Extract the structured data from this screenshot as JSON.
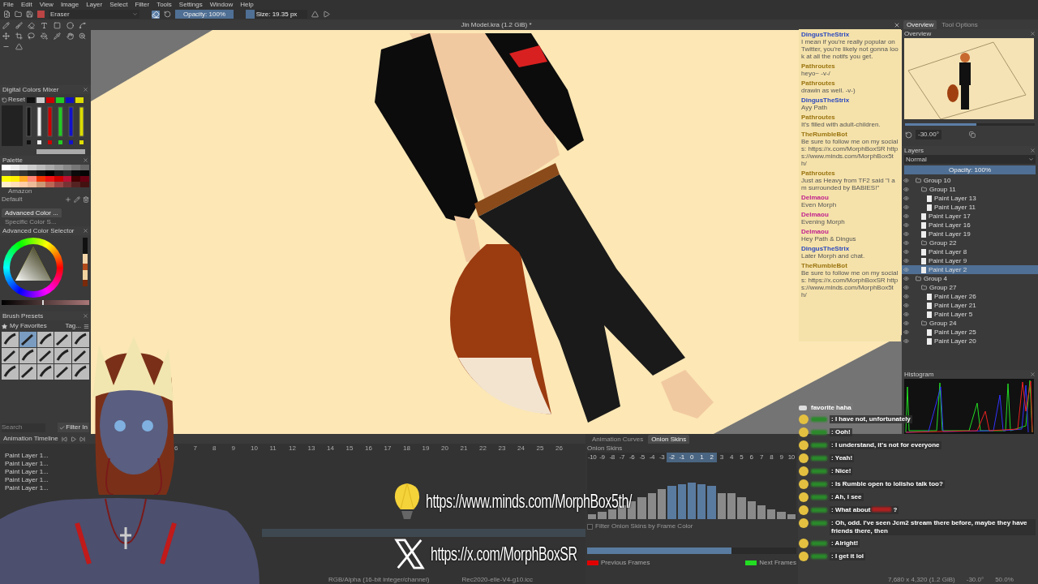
{
  "menu": [
    "File",
    "Edit",
    "View",
    "Image",
    "Layer",
    "Select",
    "Filter",
    "Tools",
    "Settings",
    "Window",
    "Help"
  ],
  "toolbar": {
    "preset": "Eraser",
    "opacity": {
      "text": "Opacity: 100%",
      "level": 1
    },
    "size": {
      "text": "Size: 19.35 px",
      "level": 0.15
    }
  },
  "mixer": {
    "title": "Digital Colors Mixer",
    "reset": "Reset",
    "colors": [
      {
        "color": "#111111"
      },
      {
        "color": "#cccccc"
      },
      {
        "color": "#cc0000"
      },
      {
        "color": "#22cc22"
      },
      {
        "color": "#1010c0"
      },
      {
        "color": "#dddd00"
      }
    ]
  },
  "palette": {
    "title": "Palette",
    "name": "Amazon",
    "set": "Default"
  },
  "color_tabs": [
    {
      "label": "Advanced Color ...",
      "selected": true
    },
    {
      "label": "Specific Color S...",
      "selected": false
    }
  ],
  "color_selector": {
    "title": "Advanced Color Selector",
    "value_slider": {
      "level": 0.48
    }
  },
  "brushes": {
    "title": "Brush Presets",
    "tag": "My Favorites",
    "tag_button": "Tag...",
    "placeholder": "Search",
    "filter": "Filter In",
    "filter_checked": true
  },
  "document": {
    "title": "Jin Model.kra (1.2 GiB) *"
  },
  "right_tabs": [
    {
      "label": "Overview",
      "selected": true
    },
    {
      "label": "Tool Options",
      "selected": false
    }
  ],
  "overview": {
    "title": "Overview",
    "rotation": "-30.00°",
    "zoom_slider": {
      "level": 0.55
    }
  },
  "layers": {
    "title": "Layers",
    "blend": "Normal",
    "opacity": {
      "text": "Opacity: 100%",
      "level": 1
    },
    "items": [
      {
        "name": "Group 10",
        "kind": "group",
        "selected": false,
        "children": [
          {
            "name": "Group 11",
            "kind": "group",
            "selected": false,
            "children": [
              {
                "name": "Paint Layer 13",
                "kind": "paint",
                "selected": false
              },
              {
                "name": "Paint Layer 11",
                "kind": "paint",
                "selected": false
              }
            ]
          },
          {
            "name": "Paint Layer 17",
            "kind": "paint",
            "selected": false
          },
          {
            "name": "Paint Layer 16",
            "kind": "paint",
            "selected": false
          },
          {
            "name": "Paint Layer 19",
            "kind": "paint",
            "selected": false
          },
          {
            "name": "Group 22",
            "kind": "group",
            "selected": false
          },
          {
            "name": "Paint Layer 8",
            "kind": "paint",
            "selected": false
          },
          {
            "name": "Paint Layer 9",
            "kind": "paint",
            "selected": false
          },
          {
            "name": "Paint Layer 2",
            "kind": "paint",
            "selected": true
          }
        ]
      },
      {
        "name": "Group 4",
        "kind": "group",
        "selected": false,
        "children": [
          {
            "name": "Group 27",
            "kind": "group",
            "selected": false,
            "children": [
              {
                "name": "Paint Layer 26",
                "kind": "paint",
                "selected": false
              },
              {
                "name": "Paint Layer 21",
                "kind": "paint",
                "selected": false
              },
              {
                "name": "Paint Layer 5",
                "kind": "paint",
                "selected": false
              }
            ]
          },
          {
            "name": "Group 24",
            "kind": "group",
            "selected": false,
            "children": [
              {
                "name": "Paint Layer 25",
                "kind": "paint",
                "selected": false
              },
              {
                "name": "Paint Layer 20",
                "kind": "paint",
                "selected": false
              }
            ]
          }
        ]
      }
    ]
  },
  "histogram": {
    "title": "Histogram"
  },
  "timeline": {
    "title": "Animation Timeline",
    "layers": [
      "Paint Layer 1...",
      "Paint Layer 1...",
      "Paint Layer 1...",
      "Paint Layer 1...",
      "Paint Layer 1..."
    ],
    "frames": [
      "6",
      "7",
      "8",
      "9",
      "10",
      "11",
      "12",
      "13",
      "14",
      "15",
      "16",
      "17",
      "18",
      "19",
      "20",
      "21",
      "22",
      "23",
      "24",
      "25",
      "26"
    ]
  },
  "onion": {
    "tabs": [
      {
        "label": "Animation Curves",
        "selected": false
      },
      {
        "label": "Onion Skins",
        "selected": true
      }
    ],
    "title": "Onion Skins",
    "frames": [
      {
        "label": "-10",
        "level": 0.08,
        "selected": false
      },
      {
        "label": "-9",
        "level": 0.13,
        "selected": false
      },
      {
        "label": "-8",
        "level": 0.17,
        "selected": false
      },
      {
        "label": "-7",
        "level": 0.24,
        "selected": false
      },
      {
        "label": "-6",
        "level": 0.31,
        "selected": false
      },
      {
        "label": "-5",
        "level": 0.38,
        "selected": false
      },
      {
        "label": "-4",
        "level": 0.46,
        "selected": false
      },
      {
        "label": "-3",
        "level": 0.53,
        "selected": false
      },
      {
        "label": "-2",
        "level": 0.59,
        "selected": true
      },
      {
        "label": "-1",
        "level": 0.62,
        "selected": true
      },
      {
        "label": "0",
        "level": 0.64,
        "selected": true
      },
      {
        "label": "1",
        "level": 0.62,
        "selected": true
      },
      {
        "label": "2",
        "level": 0.59,
        "selected": true
      },
      {
        "label": "3",
        "level": 0.46,
        "selected": false
      },
      {
        "label": "4",
        "level": 0.46,
        "selected": false
      },
      {
        "label": "5",
        "level": 0.38,
        "selected": false
      },
      {
        "label": "6",
        "level": 0.31,
        "selected": false
      },
      {
        "label": "7",
        "level": 0.24,
        "selected": false
      },
      {
        "label": "8",
        "level": 0.17,
        "selected": false
      },
      {
        "label": "9",
        "level": 0.13,
        "selected": false
      },
      {
        "label": "10",
        "level": 0.09,
        "selected": false
      }
    ],
    "filter": {
      "label": "Filter Onion Skins by Frame Color",
      "checked": false
    },
    "frame_slider": {
      "level": 0.69
    },
    "frame_sets": [
      {
        "label": "Previous Frames",
        "color": "#e00000"
      },
      {
        "label": "Next Frames",
        "color": "#22dd22"
      }
    ]
  },
  "status": {
    "profile": "RGB/Alpha (16-bit integer/channel)",
    "icc": "Rec2020-elle-V4-g10.icc",
    "size": "7,680 x 4,320 (1.2 GiB)",
    "rotation": "-30.0°",
    "zoom": "50.0%"
  },
  "chat": [
    {
      "user": "DingusTheStrix",
      "color": "#2a48c0",
      "text": "I mean if you're really popular on Twitter, you're likely not gonna look at all the notifs you get."
    },
    {
      "user": "Pathroutes",
      "color": "#9a7410",
      "text": "heyo~ -v-/"
    },
    {
      "user": "Pathroutes",
      "color": "#9a7410",
      "text": "drawin as well. -v-)"
    },
    {
      "user": "DingusTheStrix",
      "color": "#2a48c0",
      "text": "Ayy Path"
    },
    {
      "user": "Pathroutes",
      "color": "#9a7410",
      "text": "It's filled with adult-children."
    },
    {
      "user": "TheRumbleBot",
      "color": "#9a7410",
      "text": "Be sure to follow me on my socials: https://x.com/MorphBoxSR https://www.minds.com/MorphBox5th/"
    },
    {
      "user": "Pathroutes",
      "color": "#9a7410",
      "text": "Just as Heavy from TF2 said \"I am surrounded by BABIES!\""
    },
    {
      "user": "Delmaou",
      "color": "#c0208e",
      "text": "Even Morph"
    },
    {
      "user": "Delmaou",
      "color": "#c0208e",
      "text": "Evening Morph"
    },
    {
      "user": "Delmaou",
      "color": "#c0208e",
      "text": "Hey Path & Dingus"
    },
    {
      "user": "DingusTheStrix",
      "color": "#2a48c0",
      "text": "Later Morph and chat."
    },
    {
      "user": "TheRumbleBot",
      "color": "#9a7410",
      "text": "Be sure to follow me on my socials: https://x.com/MorphBoxSR https://www.minds.com/MorphBox5th/"
    }
  ],
  "chat_feed": {
    "header": "favorite haha",
    "messages": [
      {
        "prefix": ":",
        "text": "I have not, unfortunately",
        "redacted_word": false
      },
      {
        "prefix": ":",
        "text": "Ooh!",
        "redacted_word": false
      },
      {
        "prefix": ":",
        "text": "I understand, it's not for everyone",
        "redacted_word": false
      },
      {
        "prefix": ":",
        "text": "Yeah!",
        "redacted_word": false
      },
      {
        "prefix": ":",
        "text": "Nice!",
        "redacted_word": false
      },
      {
        "prefix": ":",
        "text": "Is Rumble open to lolisho talk too?",
        "redacted_word": false
      },
      {
        "prefix": ":",
        "text": "Ah, I see",
        "redacted_word": false
      },
      {
        "prefix": ":",
        "text": "What about",
        "redacted_word": true,
        "suffix": "?"
      },
      {
        "prefix": ":",
        "text": "Oh, odd. I've seen Jcm2 stream there before, maybe they have friends there, then",
        "redacted_word": false
      },
      {
        "prefix": ":",
        "text": "Alright!",
        "redacted_word": false
      },
      {
        "prefix": ":",
        "text": "I get it lol",
        "redacted_word": false
      }
    ]
  },
  "socials": [
    {
      "kind": "bulb",
      "url": "https://www.minds.com/MorphBox5th/"
    },
    {
      "kind": "x",
      "url": "https://x.com/MorphBoxSR"
    }
  ]
}
